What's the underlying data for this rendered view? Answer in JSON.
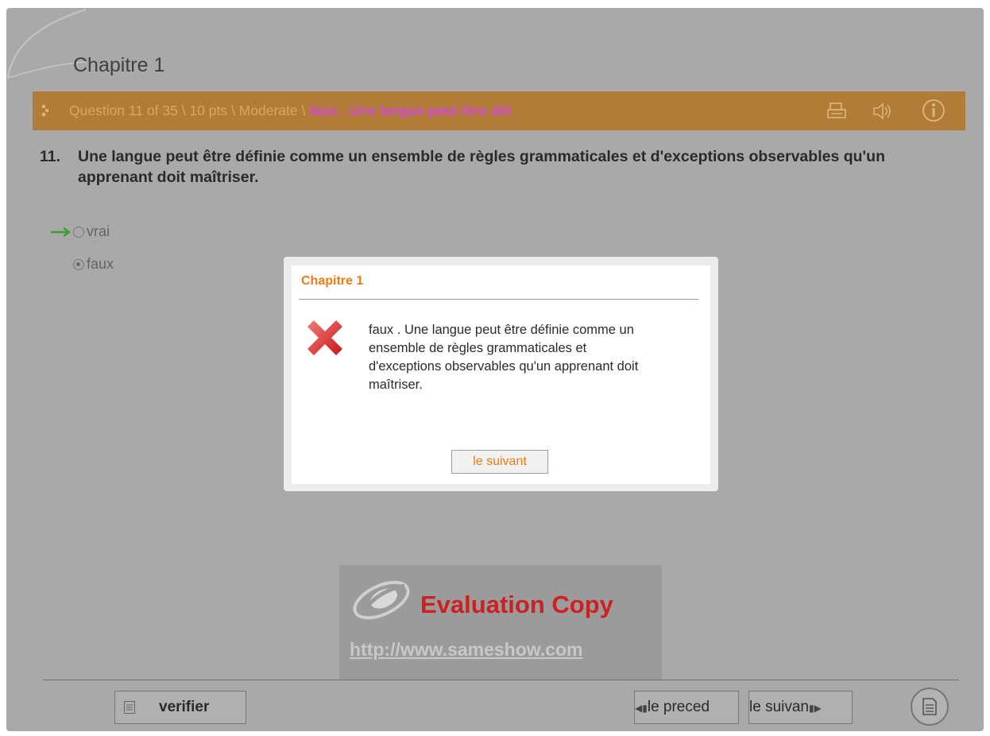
{
  "chapter": {
    "title": "Chapitre 1"
  },
  "question_bar": {
    "info": "Question 11 of 35 \\ 10 pts \\ Moderate \\ ",
    "highlight": "faux . Une langue peut être dét",
    "icons": [
      "print-icon",
      "speaker-icon",
      "info-icon"
    ]
  },
  "question": {
    "number": "11.",
    "text": "Une langue peut être définie comme un ensemble de règles grammaticales et d'exceptions observables qu'un apprenant doit maîtriser."
  },
  "options": [
    {
      "label": "vrai",
      "selected": false,
      "correct_marker": true
    },
    {
      "label": "faux",
      "selected": true,
      "correct_marker": false
    }
  ],
  "modal": {
    "title": "Chapitre 1",
    "message": "faux . Une langue peut être définie comme un ensemble de règles grammaticales et d'exceptions observables qu'un apprenant doit maîtriser.",
    "button": "le suivant",
    "icon": "x-icon"
  },
  "watermark": {
    "title": "Evaluation Copy",
    "url": "http://www.sameshow.com"
  },
  "footer": {
    "verify": "verifier",
    "prev": "le preced",
    "next": "le suivan"
  },
  "colors": {
    "accent_orange": "#ee7a13",
    "bar": "#b07c37",
    "highlight": "#d24ad0",
    "error_red": "#cd2020"
  }
}
